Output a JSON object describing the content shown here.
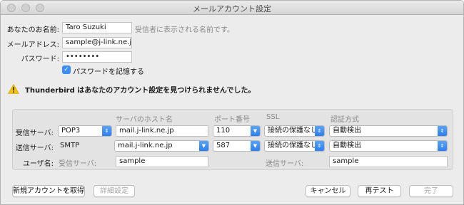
{
  "window": {
    "title": "メールアカウント設定"
  },
  "identity": {
    "name_label": "あなたのお名前:",
    "name_value": "Taro Suzuki",
    "name_hint": "受信者に表示される名前です。",
    "email_label": "メールアドレス:",
    "email_value": "sample@j-link.ne.jp",
    "password_label": "パスワード:",
    "password_value": "••••••••",
    "remember_label": "パスワードを記憶する",
    "remember_checked": true
  },
  "warning": {
    "text": "Thunderbird はあなたのアカウント設定を見つけられませんでした。"
  },
  "server": {
    "headers": {
      "hostname": "サーバのホスト名",
      "port": "ポート番号",
      "ssl": "SSL",
      "auth": "認証方式"
    },
    "incoming": {
      "label": "受信サーバ:",
      "protocol": "POP3",
      "hostname": "mail.j-link.ne.jp",
      "port": "110",
      "ssl": "接続の保護なし",
      "auth": "自動検出"
    },
    "outgoing": {
      "label": "送信サーバ:",
      "protocol": "SMTP",
      "hostname": "mail.j-link.ne.jp",
      "port": "587",
      "ssl": "接続の保護なし",
      "auth": "自動検出"
    },
    "username": {
      "label": "ユーザ名:",
      "incoming_label": "受信サーバ:",
      "incoming_value": "sample",
      "outgoing_label": "送信サーバ:",
      "outgoing_value": "sample"
    }
  },
  "buttons": {
    "new_account": "新規アカウントを取得",
    "advanced": "詳細設定",
    "cancel": "キャンセル",
    "retest": "再テスト",
    "done": "完了"
  },
  "colors": {
    "accent": "#3b8cf5",
    "warning": "#f5c400"
  }
}
